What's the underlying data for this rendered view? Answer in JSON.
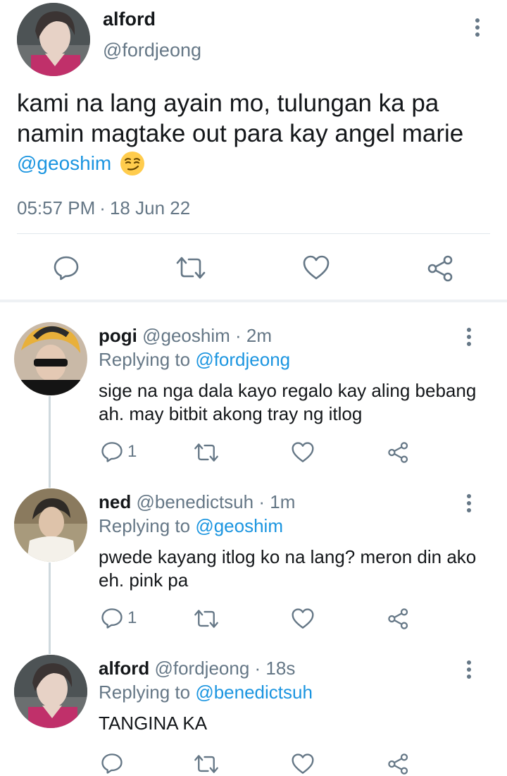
{
  "main_tweet": {
    "name": "alford",
    "handle": "@fordjeong",
    "text": "kami na lang ayain mo, tulungan ka pa namin magtake out para kay angel marie",
    "mention": "@geoshim",
    "emoji_icon": "smirking-face-emoji",
    "time": "05:57 PM",
    "separator": "·",
    "date": "18 Jun 22",
    "actions": [
      "reply-icon",
      "retweet-icon",
      "like-icon",
      "share-icon"
    ]
  },
  "replies": [
    {
      "name": "pogi",
      "handle": "@geoshim",
      "dot": "·",
      "time": "2m",
      "replying_prefix": "Replying to",
      "replying_to": "@fordjeong",
      "text": "sige na nga dala kayo regalo kay aling bebang ah. may bitbit akong tray ng itlog",
      "reply_count": "1"
    },
    {
      "name": "ned",
      "handle": "@benedictsuh",
      "dot": "·",
      "time": "1m",
      "replying_prefix": "Replying to",
      "replying_to": "@geoshim",
      "text": "pwede kayang itlog ko na lang? meron din ako eh. pink pa",
      "reply_count": "1"
    },
    {
      "name": "alford",
      "handle": "@fordjeong",
      "dot": "·",
      "time": "18s",
      "replying_prefix": "Replying to",
      "replying_to": "@benedictsuh",
      "text": "TANGINA KA",
      "reply_count": ""
    }
  ],
  "colors": {
    "link": "#1b95e0",
    "secondary": "#657786",
    "primary": "#14171a",
    "divider": "#e1e8ed"
  }
}
